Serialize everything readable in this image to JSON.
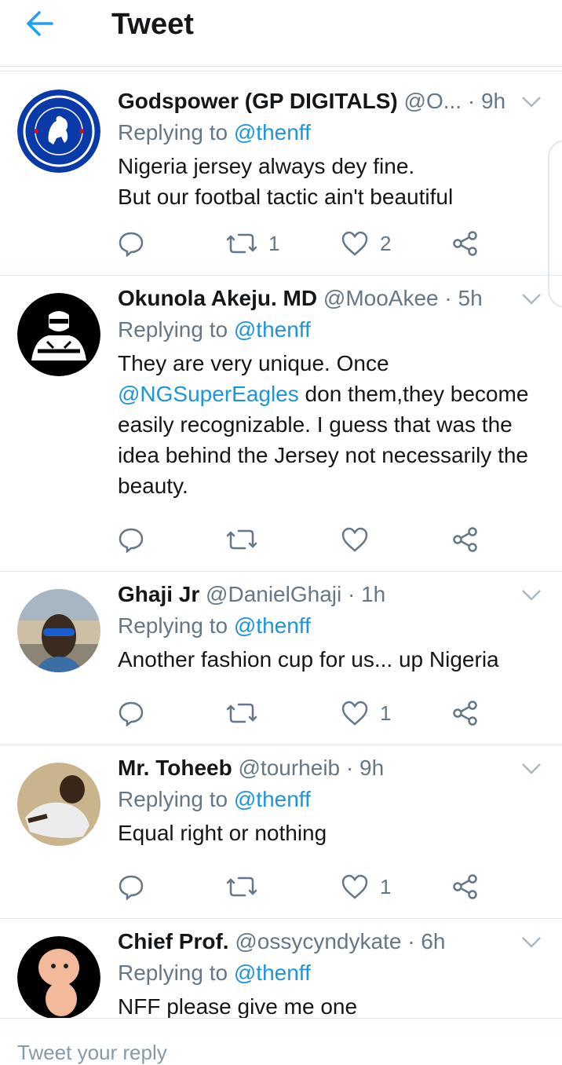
{
  "header": {
    "title": "Tweet"
  },
  "tweets": [
    {
      "name": "Godspower (GP DIGITALS)",
      "handle": "@O...",
      "time": "· 9h",
      "replying_prefix": "Replying to ",
      "replying_to": "@thenff",
      "text_lines": [
        "Nigeria jersey always dey fine.",
        "But our footbal tactic ain't beautiful"
      ],
      "retweets": "1",
      "likes": "2",
      "avatar": "chelsea-crest"
    },
    {
      "name": "Okunola Akeju. MD",
      "handle": "@MooAkee",
      "time": "· 5h",
      "replying_prefix": "Replying to ",
      "replying_to": "@thenff",
      "text_mention": "@NGSuperEagles",
      "text_before": "They are very unique. Once",
      "text_after": " don them,they become easily recognizable. I guess that was the idea behind the Jersey not necessarily the beauty.",
      "retweets": "",
      "likes": "",
      "avatar": "athlete-cartoon"
    },
    {
      "name": "Ghaji Jr",
      "handle": "@DanielGhaji",
      "time": "· 1h",
      "replying_prefix": "Replying to ",
      "replying_to": "@thenff",
      "text": "Another fashion cup for us... up Nigeria",
      "retweets": "",
      "likes": "1",
      "avatar": "photo-sunglasses"
    },
    {
      "name": "Mr. Toheeb",
      "handle": "@tourheib",
      "time": "· 9h",
      "replying_prefix": "Replying to ",
      "replying_to": "@thenff",
      "text": "Equal right or nothing",
      "retweets": "",
      "likes": "1",
      "avatar": "photo-person"
    },
    {
      "name": "Chief Prof.",
      "handle": "@ossycyndykate",
      "time": "· 6h",
      "replying_prefix": "Replying to ",
      "replying_to": "@thenff",
      "text": "NFF please give me one",
      "avatar": "baby-cartoon"
    }
  ],
  "compose": {
    "placeholder": "Tweet your reply"
  },
  "colors": {
    "accent": "#1b95e0",
    "secondary_text": "#657786",
    "divider": "#e1e8ed"
  }
}
